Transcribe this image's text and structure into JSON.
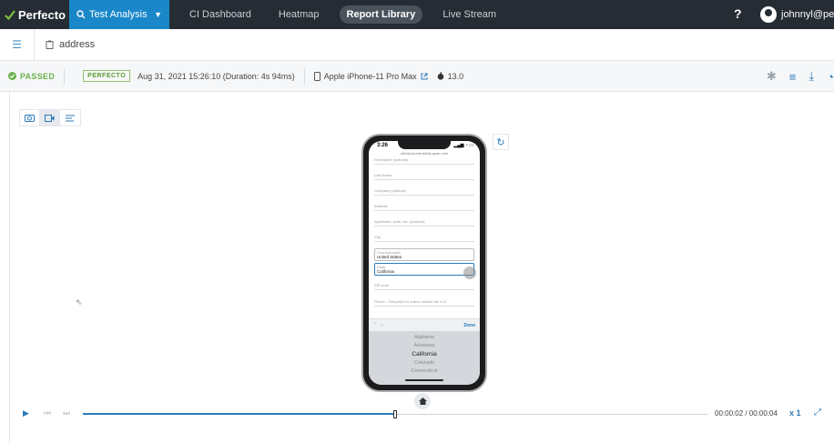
{
  "header": {
    "logo": "Perfecto",
    "active_menu": "Test Analysis",
    "nav": [
      "CI Dashboard",
      "Heatmap",
      "Report Library",
      "Live Stream"
    ],
    "help": "?",
    "user": "johnnyl@per..."
  },
  "breadcrumb": {
    "title": "address"
  },
  "status": {
    "result": "PASSED",
    "badge": "PERFECTO",
    "datetime": "Aug 31, 2021 15:26:10 (Duration: 4s 94ms)",
    "device": "Apple iPhone-11 Pro Max",
    "os_version": "13.0"
  },
  "phone": {
    "time": "3:26",
    "status_icons": "▂▄▆ ◔ ▭",
    "url": "checkout.mimicthis.qwer.com",
    "fields": [
      {
        "label": "First Name (optional)",
        "value": ""
      },
      {
        "label": "Last Name",
        "value": ""
      },
      {
        "label": "Company (optional)",
        "value": ""
      },
      {
        "label": "Address",
        "value": ""
      },
      {
        "label": "Apartment, suite, etc. (optional)",
        "value": ""
      },
      {
        "label": "City",
        "value": ""
      },
      {
        "label": "Country/region",
        "value": "United States"
      },
      {
        "label": "State",
        "value": "California"
      },
      {
        "label": "ZIP code",
        "value": ""
      },
      {
        "label": "Phone – Required for orders outside the U.S.",
        "value": ""
      }
    ],
    "keyboard_done": "Done",
    "picker": [
      "Alabama",
      "Arkansas",
      "California",
      "Colorado",
      "Connecticut"
    ],
    "picker_selected": "California"
  },
  "player": {
    "timecode": "00:00:02 / 00:00:04",
    "speed": "x 1",
    "progress": 0.5
  },
  "icons": {
    "logo": "check-mark-icon",
    "screenshot": "camera-icon",
    "video": "video-icon",
    "steps": "list-icon",
    "rotate": "rotate-icon",
    "home": "home-icon",
    "play": "play-icon",
    "fullscreen": "fullscreen-icon"
  }
}
